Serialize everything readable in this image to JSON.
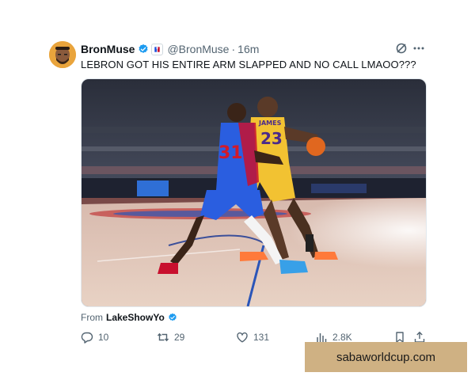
{
  "author": {
    "display_name": "BronMuse",
    "handle": "@BronMuse",
    "separator": "·",
    "time": "16m",
    "affiliate_badge": "nba"
  },
  "tweet": {
    "text": "LEBRON GOT HIS ENTIRE ARM SLAPPED AND NO CALL LMAOO???"
  },
  "media": {
    "jersey_left": "31",
    "jersey_right": "23",
    "jersey_right_name": "JAMES"
  },
  "attribution": {
    "prefix": "From",
    "user": "LakeShowYo"
  },
  "actions": {
    "replies": "10",
    "retweets": "29",
    "likes": "131",
    "views": "2.8K"
  },
  "icons": [
    "verified-badge-icon",
    "nba-affiliate-icon",
    "grok-icon",
    "more-icon",
    "reply-icon",
    "retweet-icon",
    "like-icon",
    "views-icon",
    "bookmark-icon",
    "share-icon"
  ],
  "colors": {
    "verified": "#1d9bf0",
    "text_primary": "#0f1419",
    "text_secondary": "#536471",
    "watermark_bg": "#cfb183"
  },
  "watermark": {
    "text": "sabaworldcup.com"
  }
}
